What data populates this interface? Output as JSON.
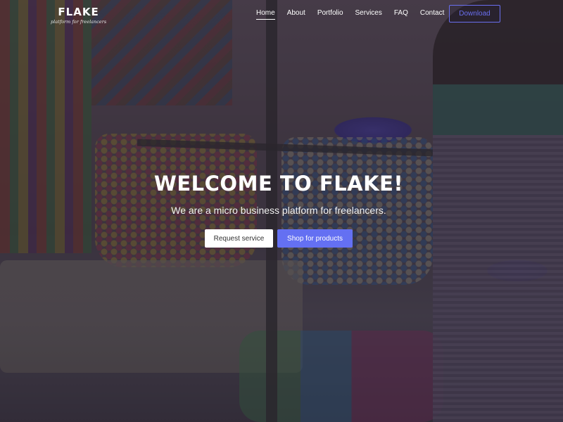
{
  "brand": {
    "name": "FLAKE",
    "tagline": "platform for freelancers"
  },
  "nav": {
    "items": [
      {
        "label": "Home",
        "active": true
      },
      {
        "label": "About"
      },
      {
        "label": "Portfolio"
      },
      {
        "label": "Services"
      },
      {
        "label": "FAQ"
      },
      {
        "label": "Contact"
      }
    ],
    "download_label": "Download"
  },
  "hero": {
    "title": "WELCOME TO FLAKE!",
    "subtitle": "We are a micro business platform for freelancers.",
    "primary_label": "Request service",
    "secondary_label": "Shop for products"
  },
  "colors": {
    "accent": "#6470f2",
    "overlay": "#282230",
    "text": "#ffffff"
  }
}
